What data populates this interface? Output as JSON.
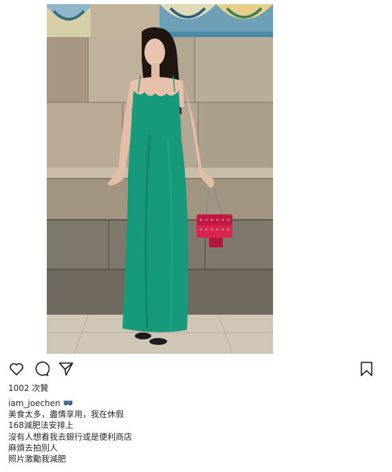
{
  "post": {
    "photo_alt": "",
    "likes_text": "1002 次贊",
    "username": "iam_joechen",
    "username_emoji": "sunglasses-emoji",
    "caption_lines": [
      "美食太多，盡情享用，我在休假",
      "168減肥法安排上",
      "沒有人想看我去銀行或是便利商店",
      "麻煩去拍別人",
      "照片激勵我減肥"
    ]
  },
  "icons": {
    "like": "heart-outline-icon",
    "comment": "speech-bubble-icon",
    "share": "paper-plane-icon",
    "save": "bookmark-icon"
  },
  "colors": {
    "text": "#262626",
    "dress": "#17997b",
    "bag": "#d8264f",
    "wall": "#a89f92"
  }
}
